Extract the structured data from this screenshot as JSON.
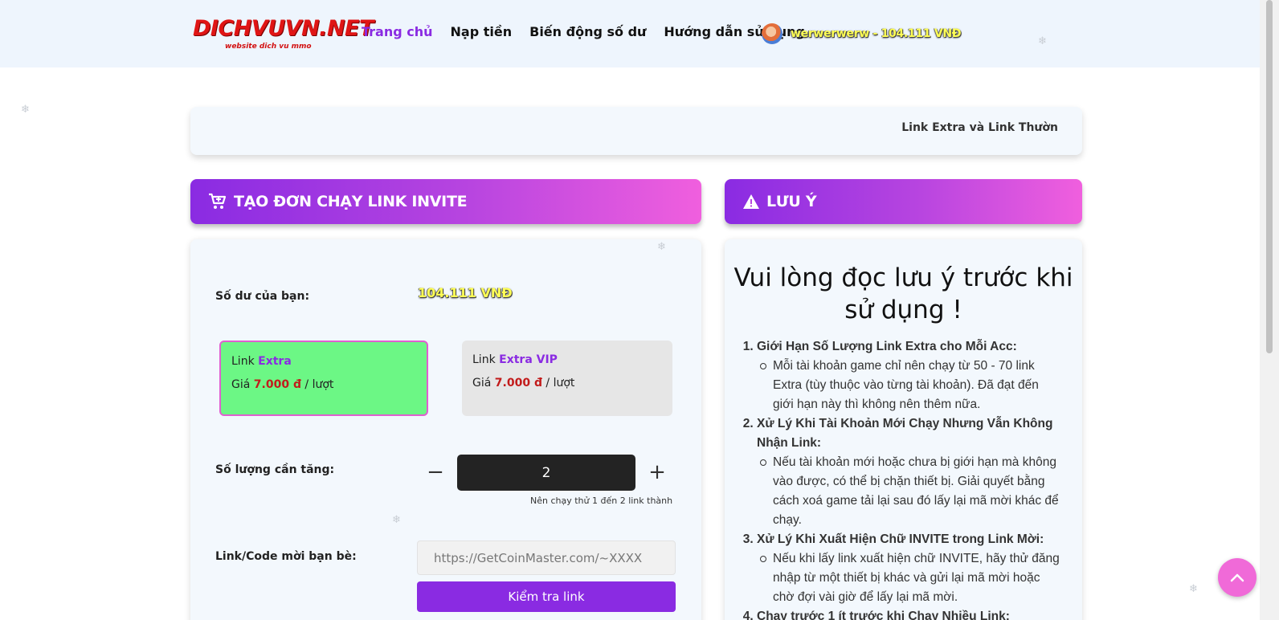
{
  "header": {
    "logo_main": "DICHVUVN.NET",
    "logo_sub": "website dich vu mmo",
    "nav": [
      {
        "label": "Trang chủ",
        "active": true
      },
      {
        "label": "Nạp tiền",
        "active": false
      },
      {
        "label": "Biến động số dư",
        "active": false
      },
      {
        "label": "Hướng dẫn sử dụng",
        "active": false
      }
    ],
    "user_text": "werwerwerw - 104.111 VNĐ"
  },
  "marquee": {
    "text": "Link Extra và Link Thườn"
  },
  "order_panel": {
    "title": "TẠO ĐƠN CHẠY LINK INVITE",
    "icon": "cart-plus-icon",
    "balance_label": "Số dư của bạn:",
    "balance_value": "104.111 VNĐ",
    "options": [
      {
        "prefix": "Link",
        "name": "Extra",
        "price_prefix": "Giá",
        "price": "7.000 đ",
        "unit": "/ lượt",
        "selected": true
      },
      {
        "prefix": "Link",
        "name": "Extra VIP",
        "price_prefix": "Giá",
        "price": "7.000 đ",
        "unit": "/ lượt",
        "selected": false
      }
    ],
    "qty_label": "Số lượng cần tăng:",
    "qty_value": "2",
    "qty_hint": "Nên chạy thử 1 đến 2 link thành",
    "link_label": "Link/Code mời bạn bè:",
    "link_placeholder": "https://GetCoinMaster.com/~XXXX",
    "check_button": "Kiểm tra link"
  },
  "notes_panel": {
    "title": "LƯU Ý",
    "icon": "warning-icon",
    "heading": "Vui lòng đọc lưu ý trước khi sử dụng !",
    "items": [
      {
        "title": "Giới Hạn Số Lượng Link Extra cho Mỗi Acc:",
        "detail": "Mỗi tài khoản game chỉ nên chạy từ 50 - 70 link Extra (tùy thuộc vào từng tài khoản). Đã đạt đến giới hạn này thì không nên thêm nữa."
      },
      {
        "title": "Xử Lý Khi Tài Khoản Mới Chạy Nhưng Vẫn Không Nhận Link:",
        "detail": "Nếu tài khoản mới hoặc chưa bị giới hạn mà không vào được, có thể bị chặn thiết bị. Giải quyết bằng cách xoá game tải lại sau đó lấy lại mã mời khác để chạy."
      },
      {
        "title": "Xử Lý Khi Xuất Hiện Chữ INVITE trong Link Mời:",
        "detail": "Nếu khi lấy link xuất hiện chữ INVITE, hãy thử đăng nhập từ một thiết bị khác và gửi lại mã mời hoặc chờ đợi vài giờ để lấy lại mã mời."
      },
      {
        "title": "Chạy trước 1 ít trước khi Chạy Nhiều Link:",
        "detail": ""
      }
    ]
  },
  "colors": {
    "accent": "#8a2be2",
    "gradient_end": "#f05fde",
    "selected_option": "#6cf785",
    "price": "#c21b1b"
  }
}
